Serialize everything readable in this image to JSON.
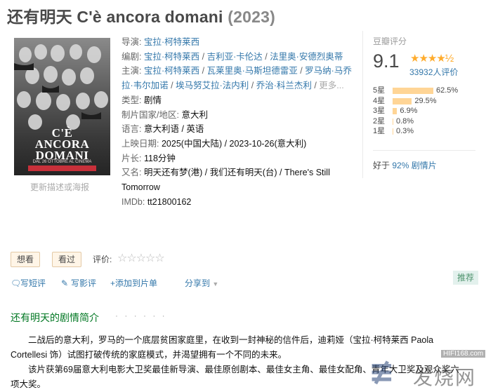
{
  "header": {
    "title": "还有明天 C'è ancora domani",
    "year": "(2023)"
  },
  "poster": {
    "title_line1": "C'È",
    "title_line2": "ANCORA DOMANI",
    "subtitle": "DAL 26 OTTOBRE AL CINEMA",
    "caption": "更新描述或海报"
  },
  "info": {
    "director_label": "导演",
    "directors": [
      "宝拉·柯特莱西"
    ],
    "writer_label": "编剧",
    "writers": [
      "宝拉·柯特莱西",
      "吉利亚·卡伦达",
      "法里奥·安德烈奥蒂"
    ],
    "cast_label": "主演",
    "cast": [
      "宝拉·柯特莱西",
      "瓦莱里奥·马斯坦德雷亚",
      "罗马纳·马乔拉·韦尔加诺",
      "埃马努艾拉·法内利",
      "乔治·科兰杰利"
    ],
    "cast_more": "更多...",
    "genre_label": "类型:",
    "genre": "剧情",
    "country_label": "制片国家/地区:",
    "country": "意大利",
    "language_label": "语言:",
    "language": "意大利语 / 英语",
    "release_label": "上映日期:",
    "release": "2025(中国大陆) / 2023-10-26(意大利)",
    "runtime_label": "片长:",
    "runtime": "118分钟",
    "aka_label": "又名:",
    "aka": "明天还有梦(港) / 我们还有明天(台) / There's Still Tomorrow",
    "imdb_label": "IMDb:",
    "imdb": "tt21800162"
  },
  "rating": {
    "label": "豆瓣评分",
    "score": "9.1",
    "stars": "★★★★½",
    "count": "33932人评价",
    "breakdown": [
      {
        "label": "5星",
        "percent": 62.5,
        "text": "62.5%"
      },
      {
        "label": "4星",
        "percent": 29.5,
        "text": "29.5%"
      },
      {
        "label": "3星",
        "percent": 6.9,
        "text": "6.9%"
      },
      {
        "label": "2星",
        "percent": 0.8,
        "text": "0.8%"
      },
      {
        "label": "1星",
        "percent": 0.3,
        "text": "0.3%"
      }
    ],
    "better_than_prefix": "好于",
    "better_than_link": "92% 剧情片"
  },
  "actions": {
    "want": "想看",
    "watched": "看过",
    "rate_label": "评价:",
    "rate_stars": "☆☆☆☆☆",
    "short_review": "写短评",
    "review": "写影评",
    "add_to_list": "+添加到片单",
    "share": "分享到",
    "recommend": "推荐"
  },
  "synopsis": {
    "title": "还有明天的剧情简介",
    "dots": "· · · · · ·",
    "p1": "二战后的意大利，罗马的一个底层贫困家庭里，在收到一封神秘的信件后，迪莉娅（宝拉·柯特莱西 Paola Cortellesi 饰）试图打破传统的家庭模式，并渴望拥有一个不同的未来。",
    "p2": "该片获第69届意大利电影大卫奖最佳新导演、最佳原创剧本、最佳女主角、最佳女配角、青年大卫奖及观众奖六项大奖。"
  },
  "watermark": {
    "url": "HIFI168.com",
    "cn": "发烧网"
  },
  "colors": {
    "link": "#3377aa",
    "star": "#ffac2d",
    "bar": "#ffd596",
    "green": "#007722"
  }
}
